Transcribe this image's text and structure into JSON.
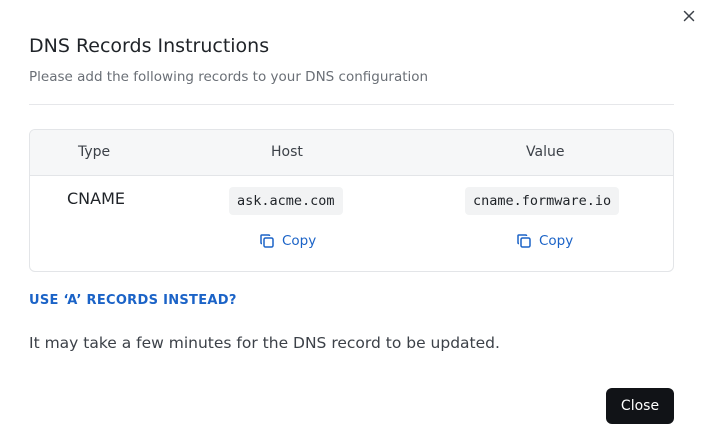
{
  "dialog": {
    "title": "DNS Records Instructions",
    "subtitle": "Please add the following records to your DNS configuration",
    "close_icon": "close-icon"
  },
  "table": {
    "headers": {
      "type": "Type",
      "host": "Host",
      "value": "Value"
    },
    "rows": [
      {
        "type": "CNAME",
        "host": "ask.acme.com",
        "value": "cname.formware.io",
        "host_copy_label": "Copy",
        "value_copy_label": "Copy"
      }
    ]
  },
  "links": {
    "use_a_records": "USE ‘A’ RECORDS INSTEAD?"
  },
  "note": "It may take a few minutes for the DNS record to be updated.",
  "footer": {
    "close_label": "Close"
  },
  "colors": {
    "accent": "#1b63c7",
    "primary_button": "#111317",
    "header_bg": "#f6f7f8",
    "code_bg": "#f2f3f4"
  }
}
